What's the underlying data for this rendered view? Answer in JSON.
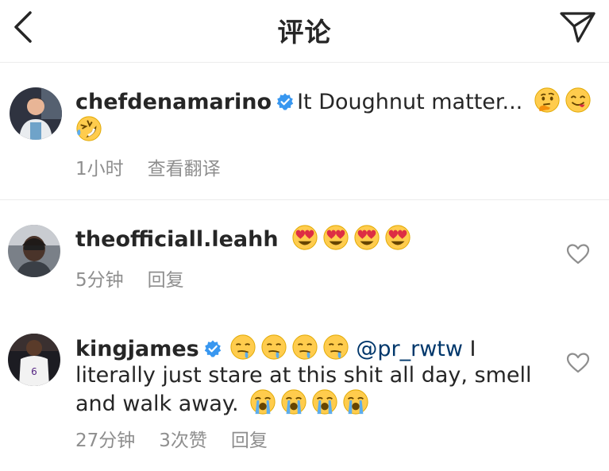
{
  "header": {
    "title": "评论"
  },
  "caption": {
    "username": "chefdenamarino",
    "text": "It Doughnut matter...",
    "time": "1小时",
    "translate": "查看翻译"
  },
  "comments": [
    {
      "username": "theofficiall.leahh",
      "text": "",
      "time": "5分钟",
      "reply": "回复"
    },
    {
      "username": "kingjames",
      "mention": "@pr_rwtw",
      "text_line1": " I",
      "text_line2": "literally just stare at this shit all day, smell",
      "text_line3": "and walk away. ",
      "time": "27分钟",
      "likes": "3次赞",
      "reply": "回复"
    }
  ],
  "icons": {
    "back": "back-chevron-icon",
    "send": "send-icon",
    "verified": "verified-badge-icon",
    "like": "heart-icon"
  },
  "colors": {
    "text": "#262626",
    "meta": "#8e8e8e",
    "link": "#00376b",
    "verified": "#3897f0"
  }
}
